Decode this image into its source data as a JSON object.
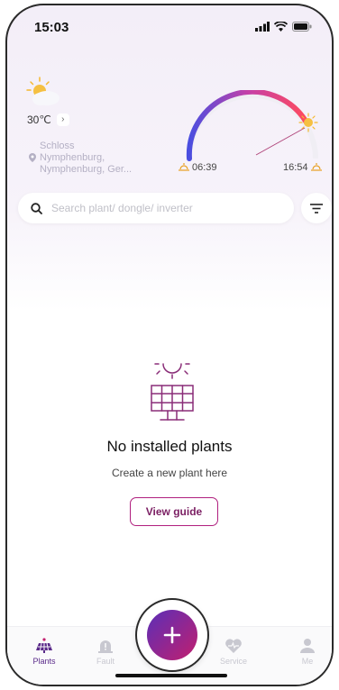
{
  "status_bar": {
    "time": "15:03"
  },
  "weather": {
    "temperature": "30℃",
    "location_line1": "Schloss",
    "location_line2": "Nymphenburg,",
    "location_line3": "Nymphenburg, Ger...",
    "sunrise": "06:39",
    "sunset": "16:54"
  },
  "search": {
    "placeholder": "Search plant/ dongle/ inverter"
  },
  "empty_state": {
    "title": "No installed plants",
    "subtitle": "Create a new plant here",
    "button": "View guide"
  },
  "tabs": [
    {
      "label": "Plants",
      "icon": "solar-panel-icon",
      "active": true
    },
    {
      "label": "Fault",
      "icon": "alert-icon",
      "active": false
    },
    {
      "label": "Service",
      "icon": "heart-icon",
      "active": false
    },
    {
      "label": "Me",
      "icon": "person-icon",
      "active": false
    }
  ],
  "colors": {
    "accent": "#5a2a8a",
    "brand_pink": "#c21f6e",
    "brand_purple": "#5a2fb8"
  }
}
